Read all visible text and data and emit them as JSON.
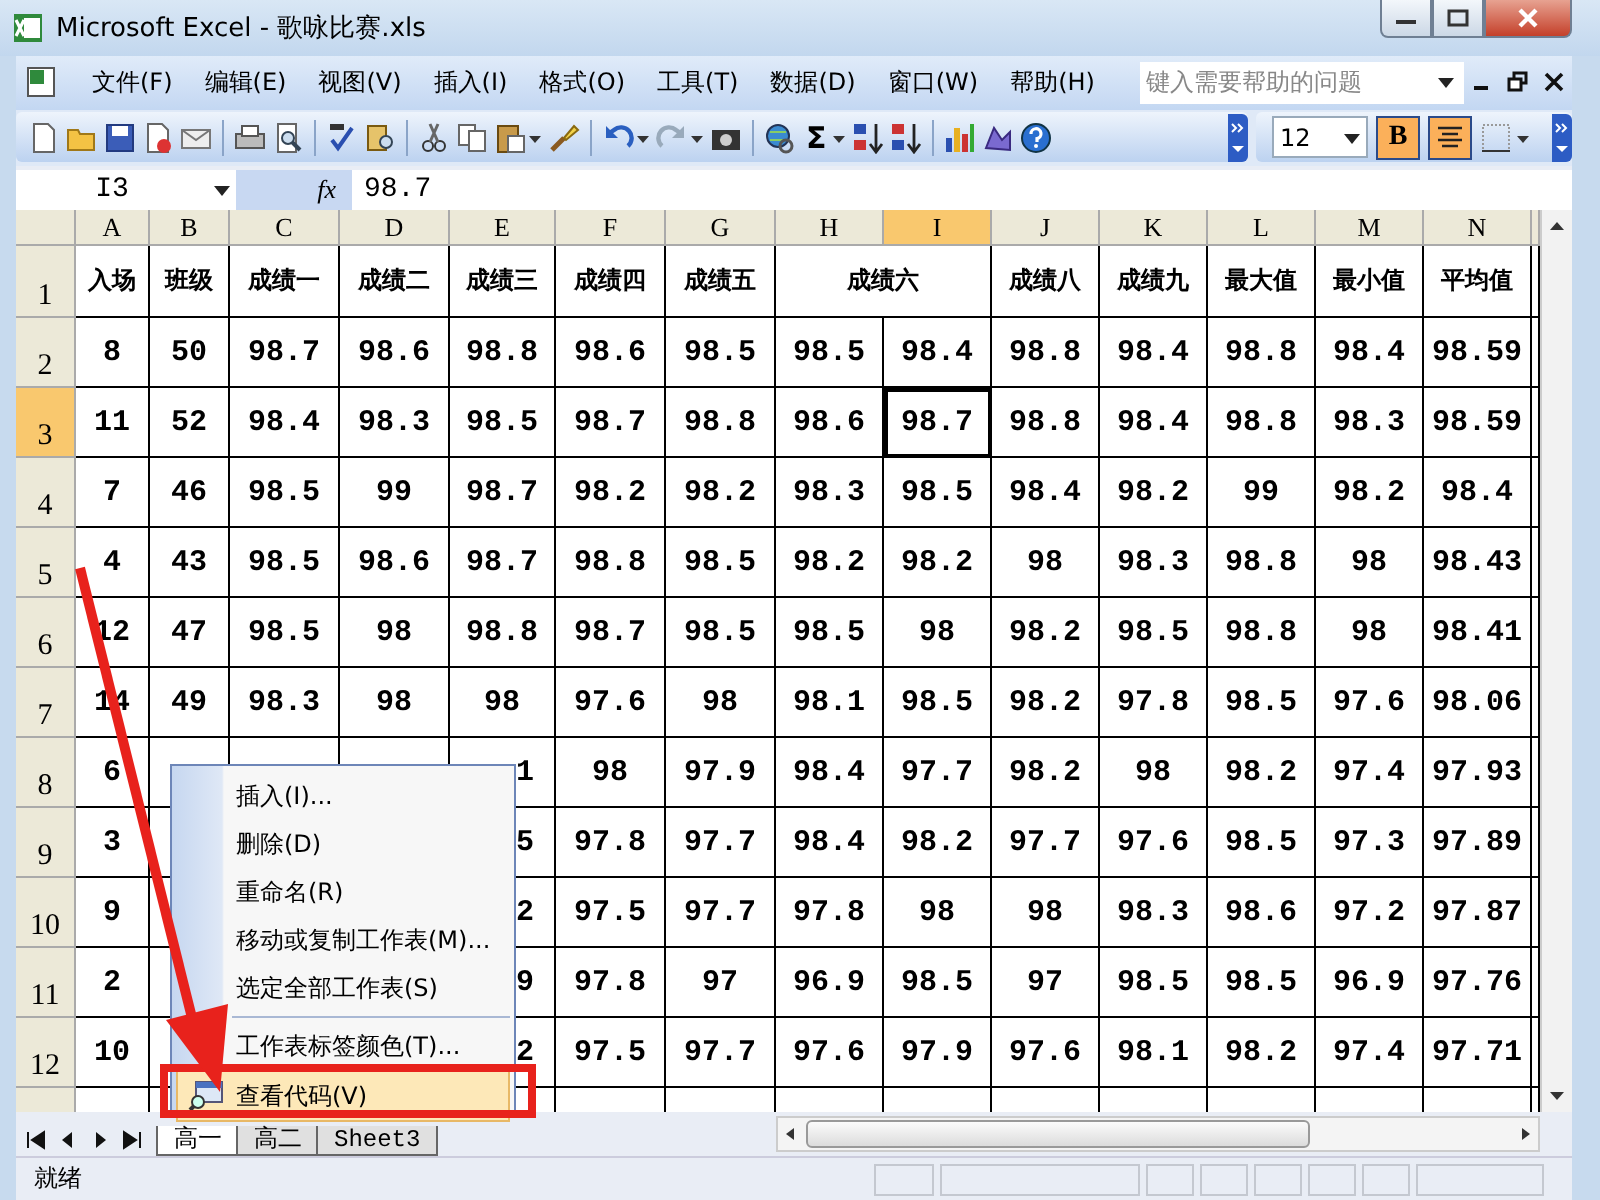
{
  "window": {
    "title": "Microsoft Excel - 歌咏比赛.xls"
  },
  "menu": [
    "文件(F)",
    "编辑(E)",
    "视图(V)",
    "插入(I)",
    "格式(O)",
    "工具(T)",
    "数据(D)",
    "窗口(W)",
    "帮助(H)"
  ],
  "help_search": {
    "placeholder": "键入需要帮助的问题"
  },
  "toolbar": {
    "sum": "Σ",
    "font_size": "12",
    "bold": {
      "label": "B",
      "on": true
    },
    "center": {
      "on": true
    }
  },
  "formula_bar": {
    "name_box": "I3",
    "function_label": "fx",
    "value": "98.7"
  },
  "sheet": {
    "columns": [
      {
        "label": "A",
        "selected": false
      },
      {
        "label": "B",
        "selected": false
      },
      {
        "label": "C",
        "selected": false
      },
      {
        "label": "D",
        "selected": false
      },
      {
        "label": "E",
        "selected": false
      },
      {
        "label": "F",
        "selected": false
      },
      {
        "label": "G",
        "selected": false
      },
      {
        "label": "H",
        "selected": false
      },
      {
        "label": "I",
        "selected": true
      },
      {
        "label": "J",
        "selected": false
      },
      {
        "label": "K",
        "selected": false
      },
      {
        "label": "L",
        "selected": false
      },
      {
        "label": "M",
        "selected": false
      },
      {
        "label": "N",
        "selected": false
      }
    ],
    "rows": [
      {
        "kind": "header",
        "number": "1",
        "selected": false,
        "cells": [
          "入场",
          "班级",
          "成绩一",
          "成绩二",
          "成绩三",
          "成绩四",
          "成绩五",
          "成绩六",
          null,
          "成绩八",
          "成绩九",
          "最大值",
          "最小值",
          "平均值"
        ]
      },
      {
        "kind": "data",
        "number": "2",
        "selected": false,
        "cells": [
          "8",
          "50",
          "98.7",
          "98.6",
          "98.8",
          "98.6",
          "98.5",
          "98.5",
          "98.4",
          "98.8",
          "98.4",
          "98.8",
          "98.4",
          "98.59"
        ]
      },
      {
        "kind": "data",
        "number": "3",
        "selected": true,
        "cells": [
          "11",
          "52",
          "98.4",
          "98.3",
          "98.5",
          "98.7",
          "98.8",
          "98.6",
          "98.7",
          "98.8",
          "98.4",
          "98.8",
          "98.3",
          "98.59"
        ]
      },
      {
        "kind": "data",
        "number": "4",
        "selected": false,
        "cells": [
          "7",
          "46",
          "98.5",
          "99",
          "98.7",
          "98.2",
          "98.2",
          "98.3",
          "98.5",
          "98.4",
          "98.2",
          "99",
          "98.2",
          "98.4"
        ]
      },
      {
        "kind": "data",
        "number": "5",
        "selected": false,
        "cells": [
          "4",
          "43",
          "98.5",
          "98.6",
          "98.7",
          "98.8",
          "98.5",
          "98.2",
          "98.2",
          "98",
          "98.3",
          "98.8",
          "98",
          "98.43"
        ]
      },
      {
        "kind": "data",
        "number": "6",
        "selected": false,
        "cells": [
          "12",
          "47",
          "98.5",
          "98",
          "98.8",
          "98.7",
          "98.5",
          "98.5",
          "98",
          "98.2",
          "98.5",
          "98.8",
          "98",
          "98.41"
        ]
      },
      {
        "kind": "data",
        "number": "7",
        "selected": false,
        "cells": [
          "14",
          "49",
          "98.3",
          "98",
          "98",
          "97.6",
          "98",
          "98.1",
          "98.5",
          "98.2",
          "97.8",
          "98.5",
          "97.6",
          "98.06"
        ]
      },
      {
        "kind": "data",
        "number": "8",
        "selected": false,
        "cells": [
          "6",
          null,
          null,
          null,
          "1",
          "98",
          "97.9",
          "98.4",
          "97.7",
          "98.2",
          "98",
          "98.2",
          "97.4",
          "97.93"
        ]
      },
      {
        "kind": "data",
        "number": "9",
        "selected": false,
        "cells": [
          "3",
          null,
          null,
          null,
          "5",
          "97.8",
          "97.7",
          "98.4",
          "98.2",
          "97.7",
          "97.6",
          "98.5",
          "97.3",
          "97.89"
        ]
      },
      {
        "kind": "data",
        "number": "10",
        "selected": false,
        "cells": [
          "9",
          null,
          null,
          null,
          "2",
          "97.5",
          "97.7",
          "97.8",
          "98",
          "98",
          "98.3",
          "98.6",
          "97.2",
          "97.87"
        ]
      },
      {
        "kind": "data",
        "number": "11",
        "selected": false,
        "cells": [
          "2",
          null,
          null,
          null,
          "9",
          "97.8",
          "97",
          "96.9",
          "98.5",
          "97",
          "98.5",
          "98.5",
          "96.9",
          "97.76"
        ]
      },
      {
        "kind": "data",
        "number": "12",
        "selected": false,
        "cells": [
          "10",
          null,
          null,
          null,
          "2",
          "97.5",
          "97.7",
          "97.6",
          "97.9",
          "97.6",
          "98.1",
          "98.2",
          "97.4",
          "97.71"
        ]
      }
    ]
  },
  "context_menu": {
    "items": [
      {
        "label": "插入(I)...",
        "highlighted": false,
        "separator_before": false,
        "icon": false
      },
      {
        "label": "删除(D)",
        "highlighted": false,
        "separator_before": false,
        "icon": false
      },
      {
        "label": "重命名(R)",
        "highlighted": false,
        "separator_before": false,
        "icon": false
      },
      {
        "label": "移动或复制工作表(M)...",
        "highlighted": false,
        "separator_before": false,
        "icon": false
      },
      {
        "label": "选定全部工作表(S)",
        "highlighted": false,
        "separator_before": false,
        "icon": false
      },
      {
        "label": "工作表标签颜色(T)...",
        "highlighted": false,
        "separator_before": true,
        "icon": false
      },
      {
        "label": "查看代码(V)",
        "highlighted": true,
        "separator_before": false,
        "icon": true
      }
    ]
  },
  "sheet_tabs": [
    {
      "label": "高一",
      "selected": true
    },
    {
      "label": "高二",
      "selected": false
    },
    {
      "label": "Sheet3",
      "selected": false
    }
  ],
  "status_bar": {
    "text": "就绪"
  }
}
